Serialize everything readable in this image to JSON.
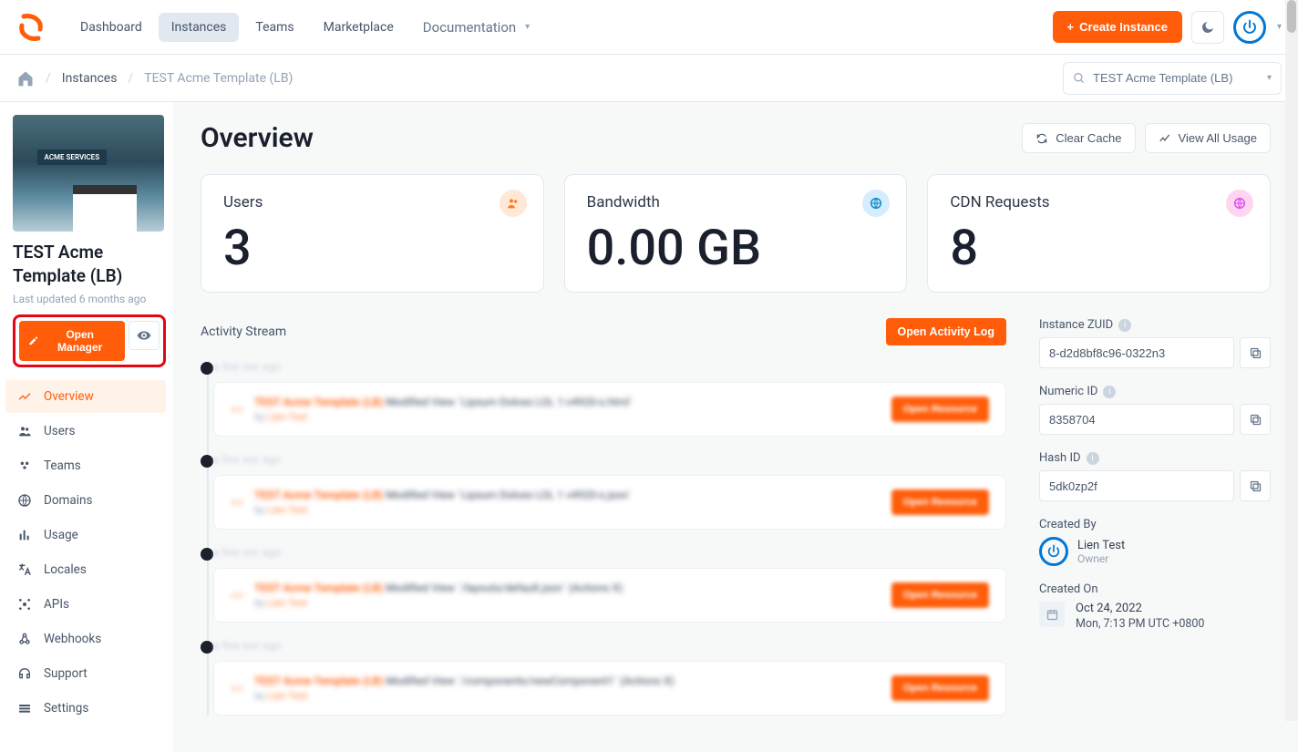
{
  "nav": {
    "items": [
      "Dashboard",
      "Instances",
      "Teams",
      "Marketplace",
      "Documentation"
    ],
    "active_index": 1,
    "create_label": "Create Instance"
  },
  "breadcrumb": {
    "link": "Instances",
    "current": "TEST Acme Template (LB)",
    "search_value": "TEST Acme Template (LB)"
  },
  "instance": {
    "title": "TEST Acme Template (LB)",
    "updated": "Last updated 6 months ago",
    "open_manager_label": "Open Manager"
  },
  "side_nav": [
    {
      "icon": "overview",
      "label": "Overview",
      "active": true
    },
    {
      "icon": "users",
      "label": "Users"
    },
    {
      "icon": "teams",
      "label": "Teams"
    },
    {
      "icon": "domains",
      "label": "Domains"
    },
    {
      "icon": "usage",
      "label": "Usage"
    },
    {
      "icon": "locales",
      "label": "Locales"
    },
    {
      "icon": "apis",
      "label": "APIs"
    },
    {
      "icon": "webhooks",
      "label": "Webhooks"
    },
    {
      "icon": "support",
      "label": "Support"
    },
    {
      "icon": "settings",
      "label": "Settings"
    }
  ],
  "overview": {
    "title": "Overview",
    "actions": {
      "clear_cache": "Clear Cache",
      "view_usage": "View All Usage"
    },
    "stats": [
      {
        "label": "Users",
        "value": "3",
        "icon": "orange"
      },
      {
        "label": "Bandwidth",
        "value": "0.00 GB",
        "icon": "blue"
      },
      {
        "label": "CDN Requests",
        "value": "8",
        "icon": "pink"
      }
    ]
  },
  "activity": {
    "title": "Activity Stream",
    "open_log_label": "Open Activity Log",
    "items": [
      {
        "time": "a few sec ago",
        "title_prefix": "TEST Acme Template (LB)",
        "title_rest": " Modified View `Lipsum Dolces LOL 1:v4920-s.html`",
        "by": "by ",
        "by_name": "Lien Test",
        "button": "Open Resource"
      },
      {
        "time": "a few sec ago",
        "title_prefix": "TEST Acme Template (LB)",
        "title_rest": " Modified View `Lipsum Dolces LOL 1 v4920-s.json`",
        "by": "by ",
        "by_name": "Lien Test",
        "button": "Open Resource"
      },
      {
        "time": "a few sec ago",
        "title_prefix": "TEST Acme Template (LB)",
        "title_rest": " Modified View `/layouts/default.json` (Actions X)",
        "by": "by ",
        "by_name": "Lien Test",
        "button": "Open Resource"
      },
      {
        "time": "a few sec ago",
        "title_prefix": "TEST Acme Template (LB)",
        "title_rest": " Modified View `/components/newComponent1` (Actions X)",
        "by": "by ",
        "by_name": "Lien Test",
        "button": "Open Resource"
      }
    ]
  },
  "info": {
    "zuid_label": "Instance ZUID",
    "zuid_value": "8-d2d8bf8c96-0322n3",
    "numeric_label": "Numeric ID",
    "numeric_value": "8358704",
    "hash_label": "Hash ID",
    "hash_value": "5dk0zp2f",
    "created_by_label": "Created By",
    "creator_name": "Lien Test",
    "creator_role": "Owner",
    "created_on_label": "Created On",
    "created_date": "Oct 24, 2022",
    "created_time": "Mon, 7:13 PM UTC +0800"
  }
}
